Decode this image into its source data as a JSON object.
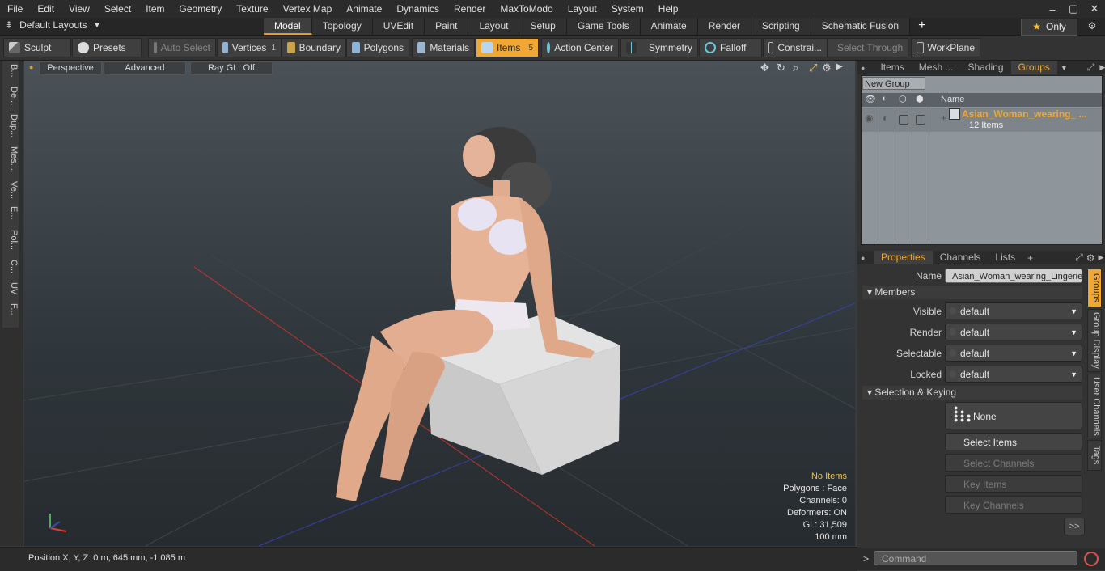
{
  "menu": [
    "File",
    "Edit",
    "View",
    "Select",
    "Item",
    "Geometry",
    "Texture",
    "Vertex Map",
    "Animate",
    "Dynamics",
    "Render",
    "MaxToModo",
    "Layout",
    "System",
    "Help"
  ],
  "layout_selector": "Default Layouts",
  "layout_tabs": [
    "Model",
    "Topology",
    "UVEdit",
    "Paint",
    "Layout",
    "Setup",
    "Game Tools",
    "Animate",
    "Render",
    "Scripting",
    "Schematic Fusion"
  ],
  "active_layout_tab": "Model",
  "only_label": "Only",
  "toolbar": {
    "sculpt": "Sculpt",
    "presets": "Presets",
    "auto_select": "Auto Select",
    "vertices": "Vertices",
    "vertices_count": "1",
    "boundary": "Boundary",
    "polygons": "Polygons",
    "materials": "Materials",
    "items": "Items",
    "items_count": "5",
    "action_center": "Action Center",
    "symmetry": "Symmetry",
    "falloff": "Falloff",
    "constraints": "Constrai...",
    "select_through": "Select Through",
    "workplane": "WorkPlane"
  },
  "left_tabs": [
    "B...",
    "De...",
    "Dup...",
    "Mes...",
    "Ve...",
    "E...",
    "Pol...",
    "C...",
    "UV",
    "F..."
  ],
  "viewport": {
    "perspective": "Perspective",
    "advanced": "Advanced",
    "raygl": "Ray GL: Off",
    "info": {
      "selection": "No Items",
      "polygons": "Polygons : Face",
      "channels": "Channels: 0",
      "deformers": "Deformers: ON",
      "gl": "GL: 31,509",
      "scale": "100 mm"
    }
  },
  "status": {
    "position": "Position X, Y, Z:   0 m, 645 mm, -1.085 m"
  },
  "groups_panel": {
    "tabs": [
      "Items",
      "Mesh ...",
      "Shading",
      "Groups"
    ],
    "active_tab": "Groups",
    "new_group": "New Group",
    "name_header": "Name",
    "group_name": "Asian_Woman_wearing_ ...",
    "group_count": "12 Items"
  },
  "properties_panel": {
    "tabs": [
      "Properties",
      "Channels",
      "Lists"
    ],
    "active_tab": "Properties",
    "name_label": "Name",
    "name_value": "Asian_Woman_wearing_Lingerie_",
    "members_section": "Members",
    "visible_label": "Visible",
    "visible_value": "default",
    "render_label": "Render",
    "render_value": "default",
    "selectable_label": "Selectable",
    "selectable_value": "default",
    "locked_label": "Locked",
    "locked_value": "default",
    "selection_section": "Selection & Keying",
    "none_button": "None",
    "select_items": "Select Items",
    "select_channels": "Select Channels",
    "key_items": "Key Items",
    "key_channels": "Key Channels",
    "more": ">>",
    "side_tabs": [
      "Groups",
      "Group Display",
      "User Channels",
      "Tags"
    ]
  },
  "command_placeholder": "Command",
  "colors": {
    "accent": "#f0a733",
    "group_name": "#f0a733"
  }
}
